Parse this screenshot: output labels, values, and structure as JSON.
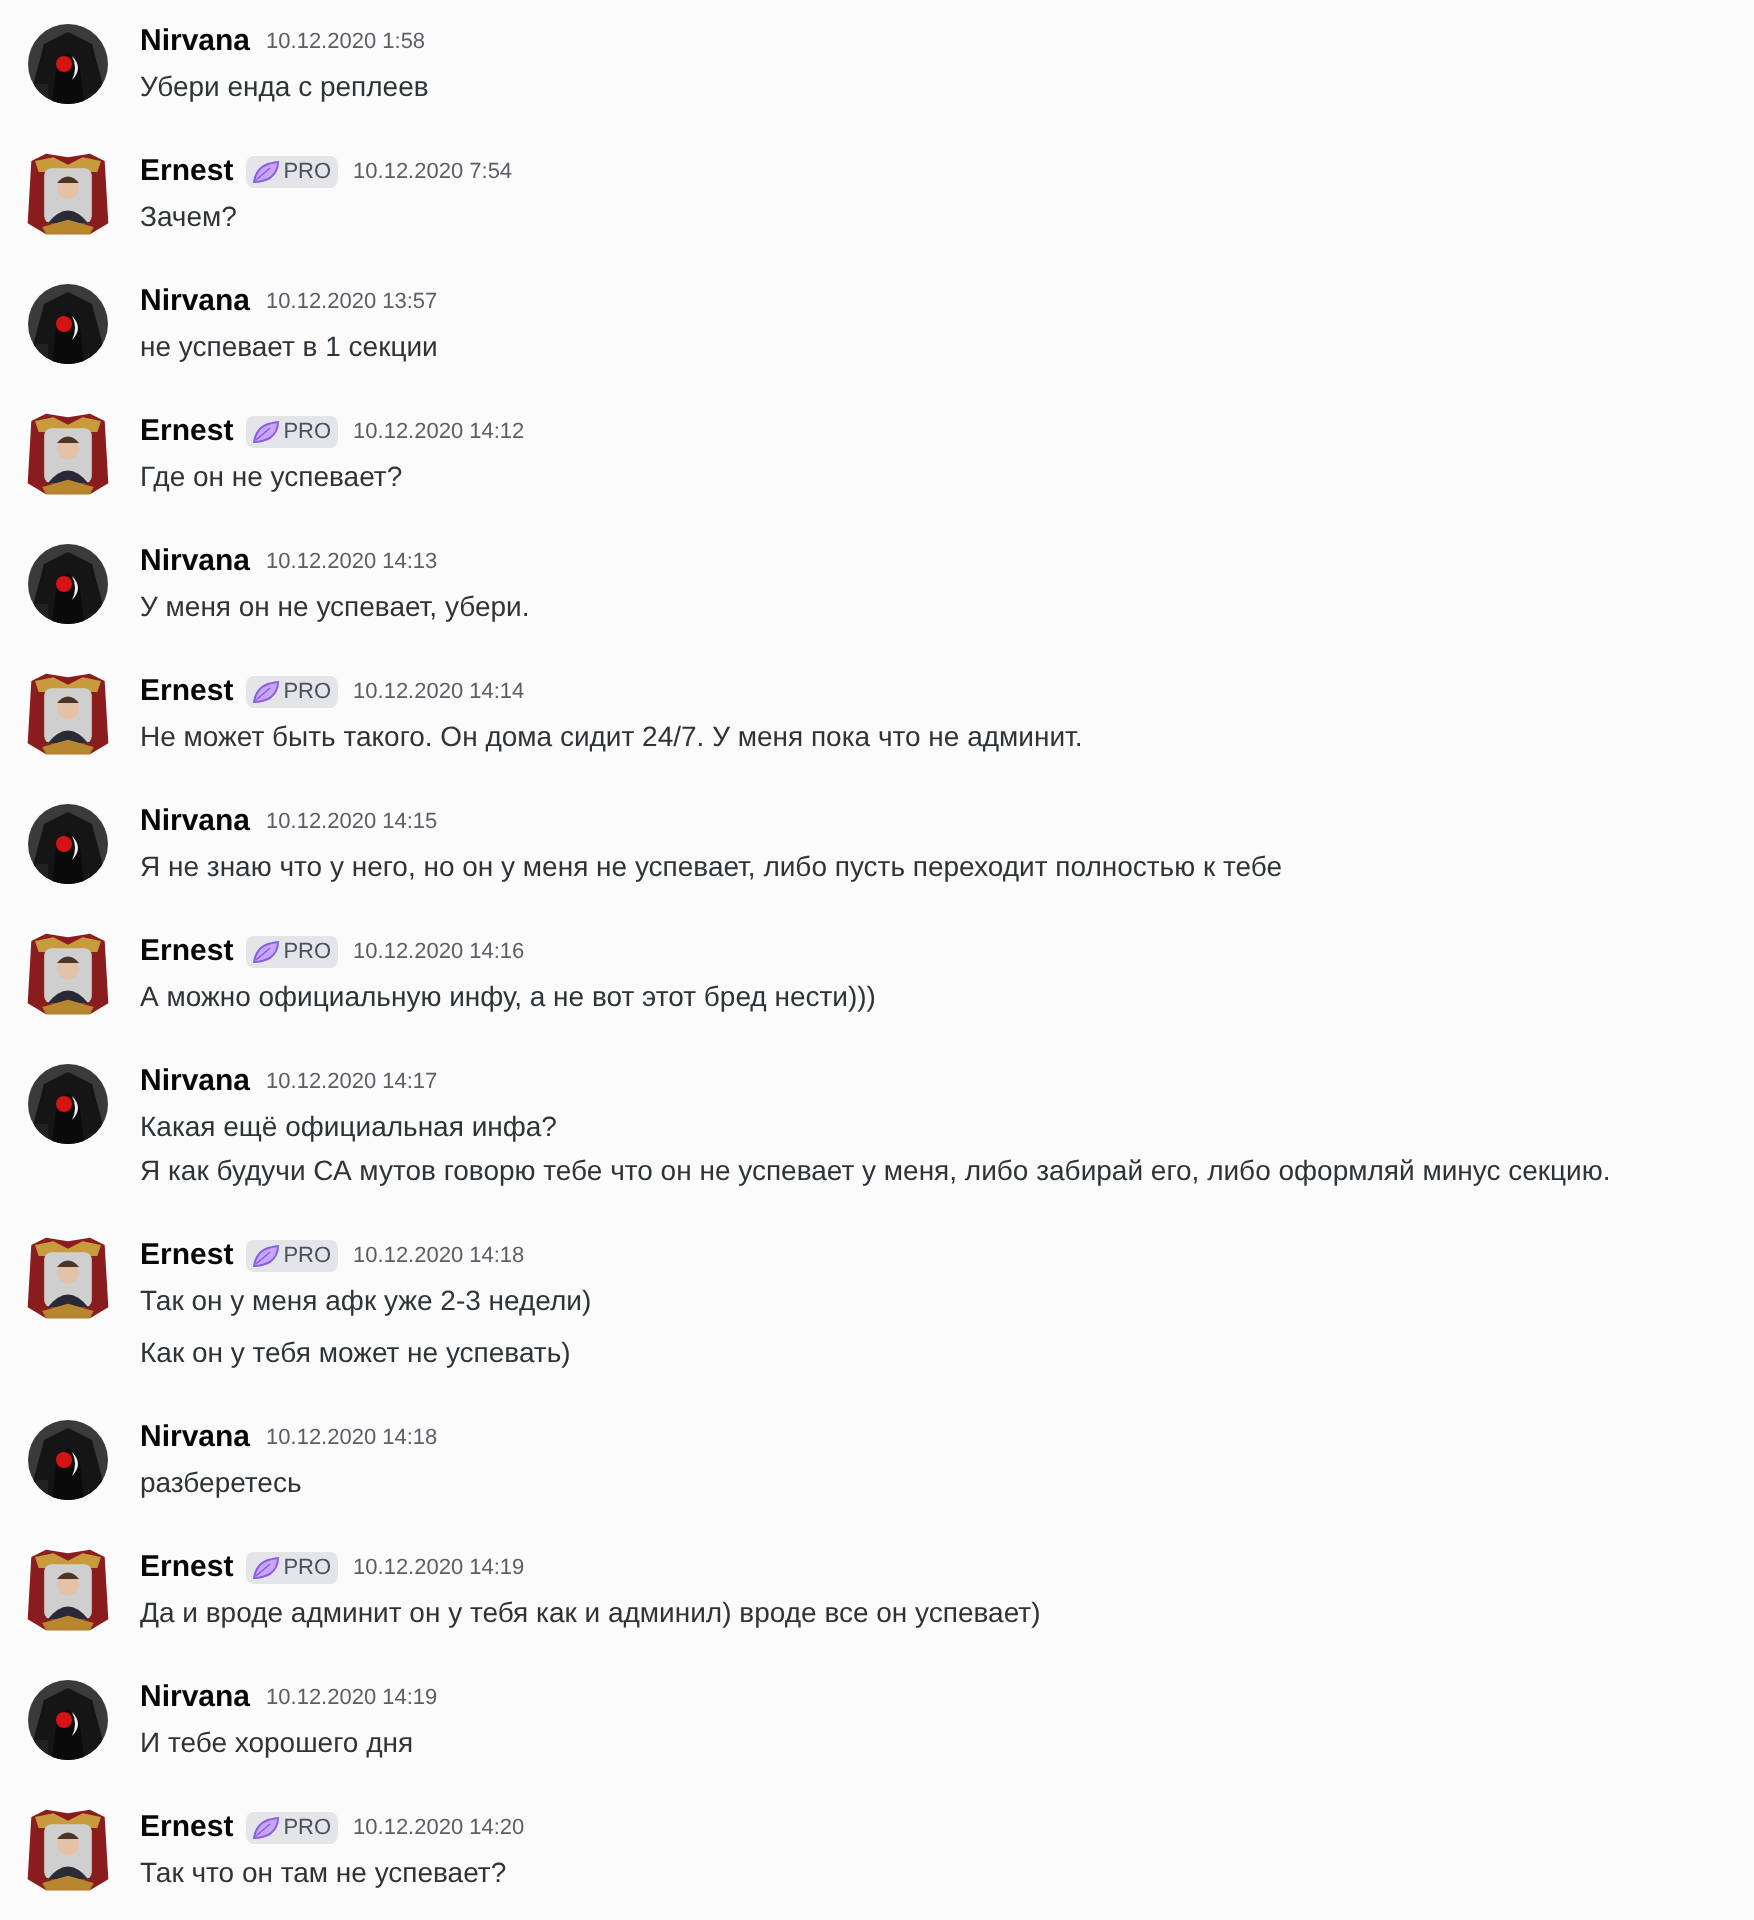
{
  "messages": [
    {
      "author": "Nirvana",
      "kind": "dark",
      "time": "10.12.2020 1:58",
      "lines": [
        "Убери енда с реплеев"
      ]
    },
    {
      "author": "Ernest",
      "kind": "framed",
      "badge": "PRO",
      "time": "10.12.2020 7:54",
      "lines": [
        "Зачем?"
      ]
    },
    {
      "author": "Nirvana",
      "kind": "dark",
      "time": "10.12.2020 13:57",
      "lines": [
        "не успевает в 1 секции"
      ]
    },
    {
      "author": "Ernest",
      "kind": "framed",
      "badge": "PRO",
      "time": "10.12.2020 14:12",
      "lines": [
        "Где он не успевает?"
      ]
    },
    {
      "author": "Nirvana",
      "kind": "dark",
      "time": "10.12.2020 14:13",
      "lines": [
        "У меня он не успевает, убери."
      ]
    },
    {
      "author": "Ernest",
      "kind": "framed",
      "badge": "PRO",
      "time": "10.12.2020 14:14",
      "lines": [
        "Не может быть такого. Он дома сидит 24/7. У меня пока что не админит."
      ]
    },
    {
      "author": "Nirvana",
      "kind": "dark",
      "time": "10.12.2020 14:15",
      "lines": [
        "Я не знаю что у него, но он у меня не успевает, либо пусть переходит полностью к тебе"
      ]
    },
    {
      "author": "Ernest",
      "kind": "framed",
      "badge": "PRO",
      "time": "10.12.2020 14:16",
      "lines": [
        "А можно официальную инфу, а не вот этот бред нести)))"
      ]
    },
    {
      "author": "Nirvana",
      "kind": "dark",
      "time": "10.12.2020 14:17",
      "lines": [
        "Какая ещё официальная инфа?\nЯ как будучи СА мутов говорю тебе что он не успевает у меня, либо забирай его, либо оформляй минус секцию."
      ]
    },
    {
      "author": "Ernest",
      "kind": "framed",
      "badge": "PRO",
      "time": "10.12.2020 14:18",
      "lines": [
        "Так он у меня афк уже 2-3 недели)",
        "Как он у тебя может не успевать)"
      ]
    },
    {
      "author": "Nirvana",
      "kind": "dark",
      "time": "10.12.2020 14:18",
      "lines": [
        "разберетесь"
      ]
    },
    {
      "author": "Ernest",
      "kind": "framed",
      "badge": "PRO",
      "time": "10.12.2020 14:19",
      "lines": [
        "Да и вроде админит он у тебя как и админил) вроде все он успевает)"
      ]
    },
    {
      "author": "Nirvana",
      "kind": "dark",
      "time": "10.12.2020 14:19",
      "lines": [
        "И тебе хорошего дня"
      ]
    },
    {
      "author": "Ernest",
      "kind": "framed",
      "badge": "PRO",
      "time": "10.12.2020 14:20",
      "lines": [
        "Так что он там не успевает?"
      ]
    }
  ]
}
